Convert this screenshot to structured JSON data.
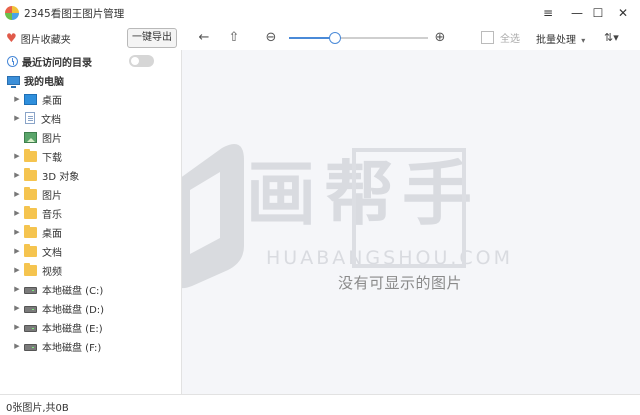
{
  "app": {
    "title": "2345看图王图片管理",
    "icon": "app-logo-icon"
  },
  "window_controls": {
    "menu": "≡",
    "minimize": "—",
    "maximize": "☐",
    "close": "✕"
  },
  "toolbar": {
    "favorites_label": "图片收藏夹",
    "export_label": "一键导出",
    "back_icon": "←",
    "up_icon": "⇧",
    "zoom_out_icon": "⊖",
    "zoom_in_icon": "⊕",
    "zoom_level": 0.33,
    "select_all_label": "全选",
    "batch_label": "批量处理",
    "batch_caret": "▾",
    "sort_icon": "⇅▾",
    "accent": "#4a8ad8"
  },
  "sidebar": {
    "recent_label": "最近访问的目录",
    "recent_toggle_on": false,
    "pc_label": "我的电脑",
    "items": [
      {
        "label": "桌面",
        "icon": "desktop-icon",
        "expandable": true
      },
      {
        "label": "文档",
        "icon": "document-icon",
        "expandable": true
      },
      {
        "label": "图片",
        "icon": "picture-icon",
        "expandable": false
      },
      {
        "label": "下载",
        "icon": "folder-icon",
        "expandable": true
      },
      {
        "label": "3D 对象",
        "icon": "folder-icon",
        "expandable": true
      },
      {
        "label": "图片",
        "icon": "folder-icon",
        "expandable": true
      },
      {
        "label": "音乐",
        "icon": "folder-icon",
        "expandable": true
      },
      {
        "label": "桌面",
        "icon": "folder-icon",
        "expandable": true
      },
      {
        "label": "文档",
        "icon": "folder-icon",
        "expandable": true
      },
      {
        "label": "视频",
        "icon": "folder-icon",
        "expandable": true
      },
      {
        "label": "本地磁盘 (C:)",
        "icon": "drive-icon",
        "expandable": true
      },
      {
        "label": "本地磁盘 (D:)",
        "icon": "drive-icon",
        "expandable": true
      },
      {
        "label": "本地磁盘 (E:)",
        "icon": "drive-icon",
        "expandable": true
      },
      {
        "label": "本地磁盘 (F:)",
        "icon": "drive-icon",
        "expandable": true
      }
    ]
  },
  "main": {
    "empty_message": "没有可显示的图片",
    "watermark": {
      "brand": "画帮手",
      "domain": "HUABANGSHOU.COM"
    }
  },
  "status": {
    "text": "0张图片,共0B"
  }
}
